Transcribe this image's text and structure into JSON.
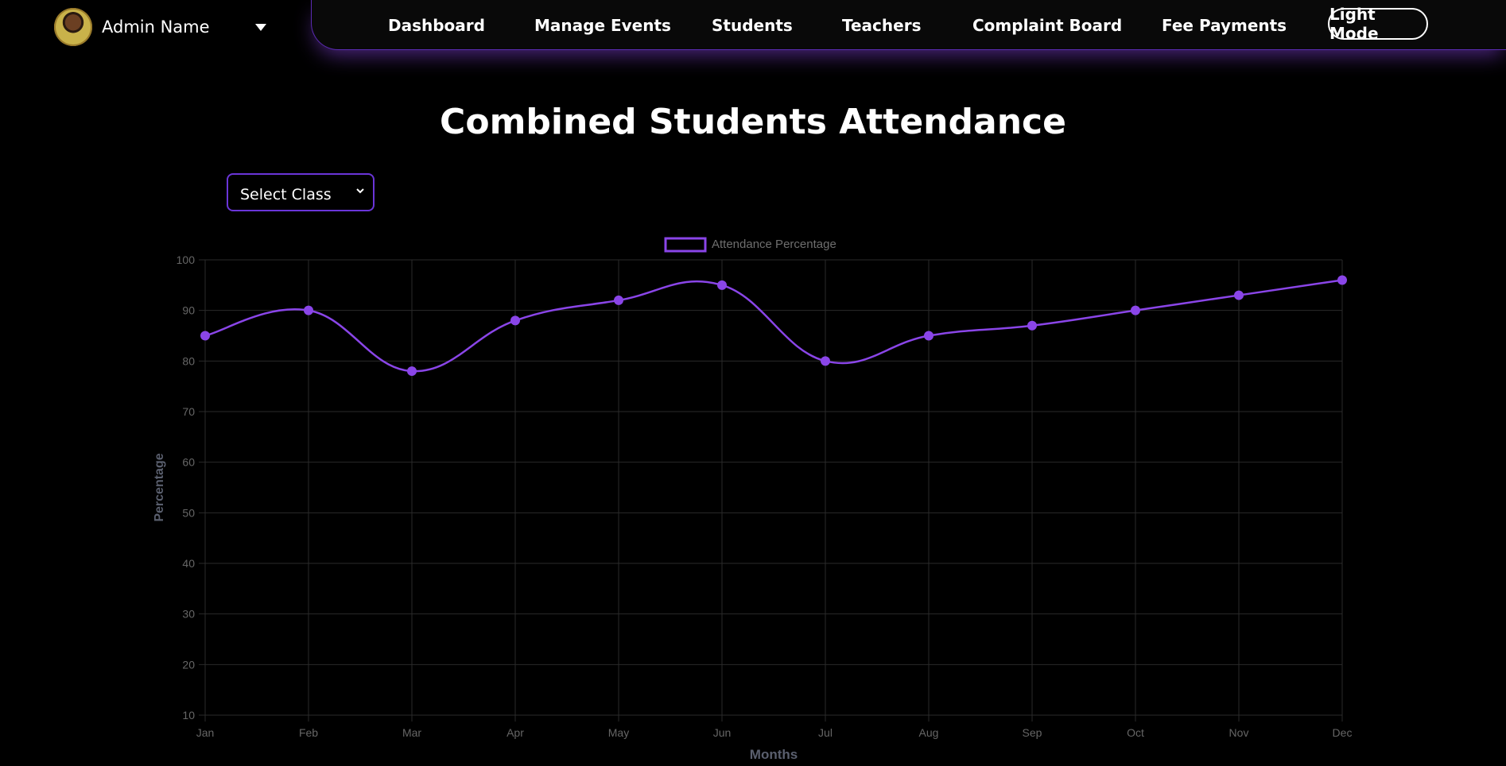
{
  "user": {
    "name": "Admin Name"
  },
  "nav": {
    "items": [
      "Dashboard",
      "Manage Events",
      "Students",
      "Teachers",
      "Complaint Board",
      "Fee Payments"
    ],
    "mode_toggle": "Light Mode"
  },
  "page": {
    "title": "Combined Students Attendance",
    "class_select": {
      "selected": "Select Class"
    }
  },
  "colors": {
    "accent": "#8a45e8",
    "navbar_border": "#5b2bb3",
    "background": "#000000"
  },
  "icons": {
    "dropdown": "caret-down-icon",
    "select_chevron": "chevron-down-icon",
    "avatar": "user-avatar"
  },
  "chart_data": {
    "type": "line",
    "categories": [
      "Jan",
      "Feb",
      "Mar",
      "Apr",
      "May",
      "Jun",
      "Jul",
      "Aug",
      "Sep",
      "Oct",
      "Nov",
      "Dec"
    ],
    "series": [
      {
        "name": "Attendance Percentage",
        "values": [
          85,
          90,
          78,
          88,
          92,
          95,
          80,
          85,
          87,
          90,
          93,
          96
        ],
        "color": "#8a45e8"
      }
    ],
    "xlabel": "Months",
    "ylabel": "Percentage",
    "ylim": [
      10,
      100
    ],
    "yticks": [
      10,
      20,
      30,
      40,
      50,
      60,
      70,
      80,
      90,
      100
    ],
    "grid": true,
    "legend": "top-center"
  }
}
